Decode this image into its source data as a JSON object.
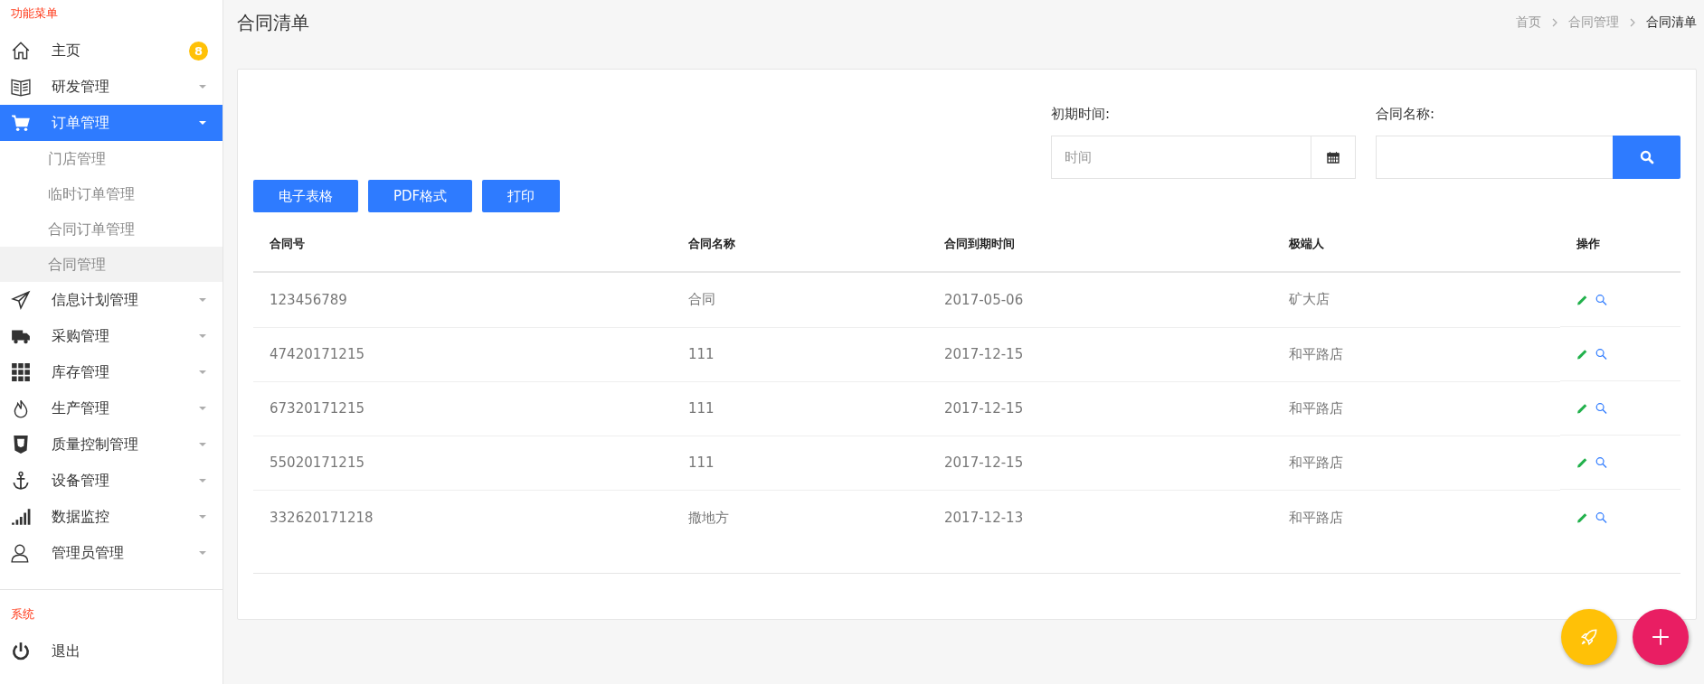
{
  "sidebar": {
    "section_title": "功能菜单",
    "items": [
      {
        "label": "主页",
        "badge": "8",
        "selected": false
      },
      {
        "label": "研发管理",
        "expanded": false,
        "selected": false
      },
      {
        "label": "订单管理",
        "expanded": true,
        "selected": true,
        "children": [
          {
            "label": "门店管理",
            "selected": false
          },
          {
            "label": "临时订单管理",
            "selected": false
          },
          {
            "label": "合同订单管理",
            "selected": false
          },
          {
            "label": "合同管理",
            "selected": true
          }
        ]
      },
      {
        "label": "信息计划管理",
        "expanded": false,
        "selected": false
      },
      {
        "label": "采购管理",
        "expanded": false,
        "selected": false
      },
      {
        "label": "库存管理",
        "expanded": false,
        "selected": false
      },
      {
        "label": "生产管理",
        "expanded": false,
        "selected": false
      },
      {
        "label": "质量控制管理",
        "expanded": false,
        "selected": false
      },
      {
        "label": "设备管理",
        "expanded": false,
        "selected": false
      },
      {
        "label": "数据监控",
        "expanded": false,
        "selected": false
      },
      {
        "label": "管理员管理",
        "expanded": false,
        "selected": false
      }
    ],
    "system_title": "系统",
    "system_items": [
      {
        "label": "退出"
      }
    ]
  },
  "page_title": "合同清单",
  "breadcrumb": [
    {
      "label": "首页",
      "current": false
    },
    {
      "label": "合同管理",
      "current": false
    },
    {
      "label": "合同清单",
      "current": true
    }
  ],
  "filters": {
    "date_label": "初期时间:",
    "date_placeholder": "时间",
    "name_label": "合同名称:"
  },
  "export_buttons": [
    "电子表格",
    "PDF格式",
    "打印"
  ],
  "table": {
    "columns": [
      "合同号",
      "合同名称",
      "合同到期时间",
      "极端人",
      "操作"
    ],
    "rows": [
      [
        "123456789",
        "合同",
        "2017-05-06",
        "矿大店"
      ],
      [
        "47420171215",
        "111",
        "2017-12-15",
        "和平路店"
      ],
      [
        "67320171215",
        "111",
        "2017-12-15",
        "和平路店"
      ],
      [
        "55020171215",
        "111",
        "2017-12-15",
        "和平路店"
      ],
      [
        "332620171218",
        "撒地方",
        "2017-12-13",
        "和平路店"
      ]
    ]
  }
}
